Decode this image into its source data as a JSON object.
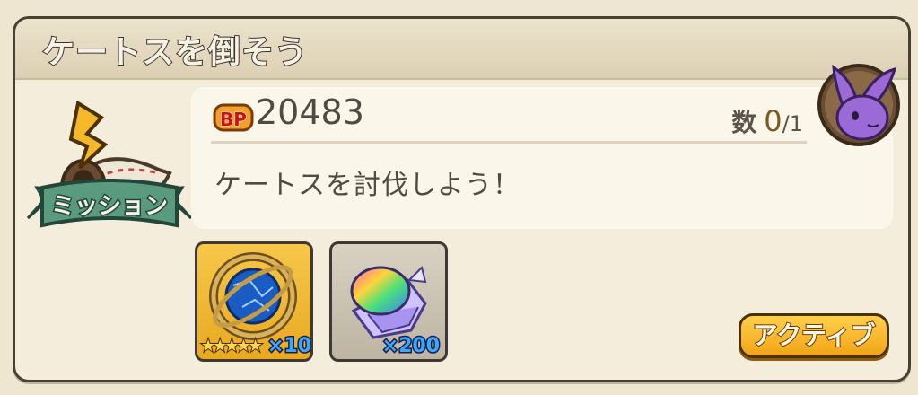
{
  "mission": {
    "title": "ケートスを倒そう",
    "badge_label": "ミッション",
    "bp_icon_text": "BP",
    "bp_value": "20483",
    "count_label": "数",
    "count_current": "0",
    "count_total": "/1",
    "description": "ケートスを討伐しよう！",
    "avatar_icon": "purple-rabbit-icon"
  },
  "rewards": [
    {
      "name": "gold-globe-reward",
      "rarity_stars": "★★★★★",
      "rarity": 5,
      "quantity": "×10"
    },
    {
      "name": "rainbow-crystal-reward",
      "quantity": "×200"
    }
  ],
  "action": {
    "button_label": "アクティブ"
  },
  "colors": {
    "accent": "#f2a417",
    "background": "#efe6d2",
    "border": "#4a3f33",
    "quantity_text": "#3aa8ff"
  }
}
